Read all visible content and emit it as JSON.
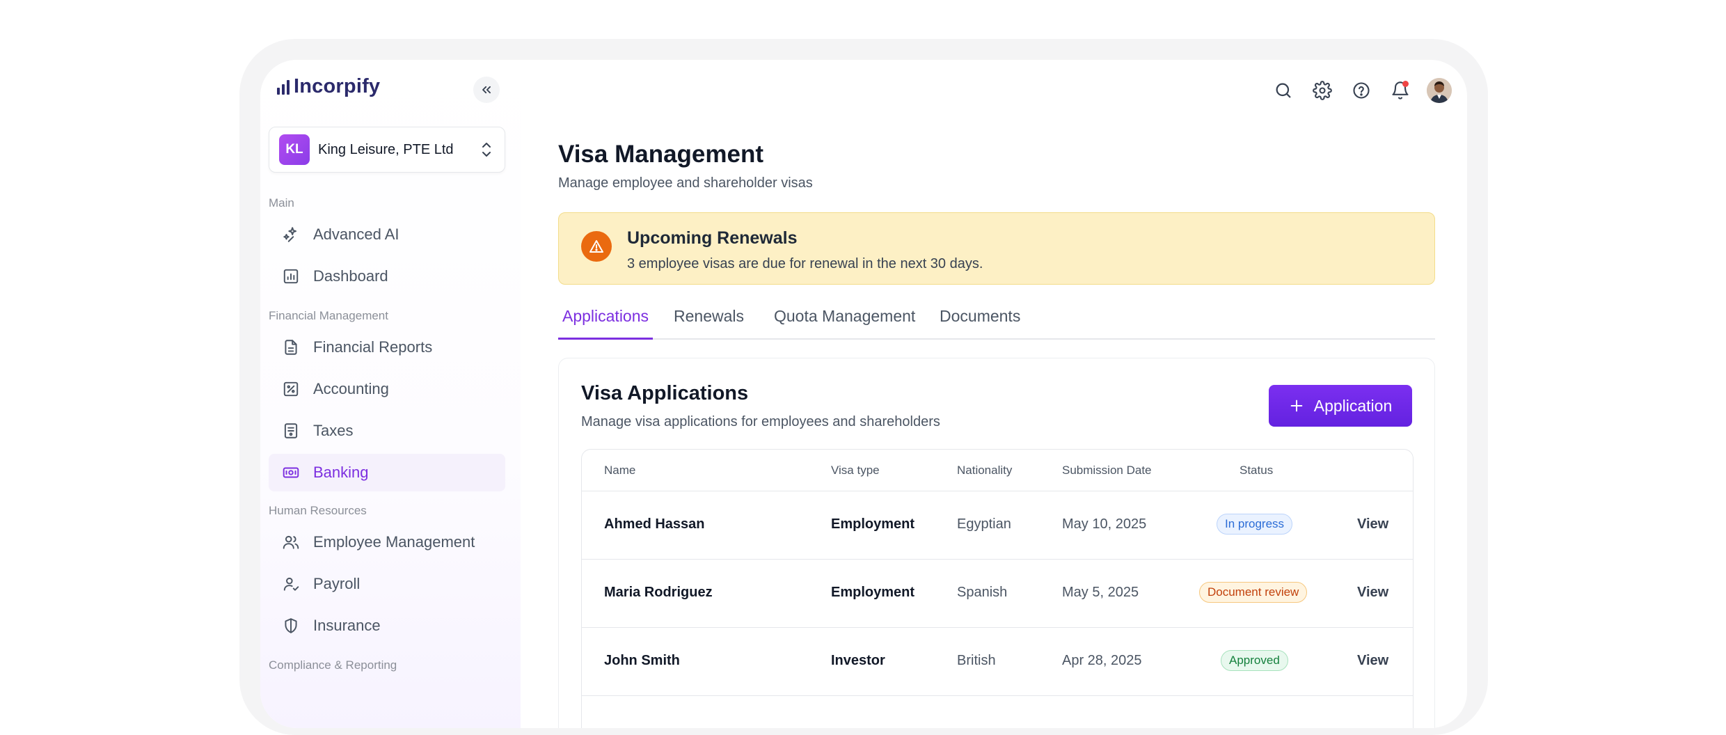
{
  "brand": {
    "name": "Incorpify"
  },
  "company": {
    "initials": "KL",
    "name": "King Leisure, PTE Ltd"
  },
  "sidebar": {
    "sections": [
      "Main",
      "Financial Management",
      "Human Resources",
      "Compliance & Reporting"
    ],
    "items": [
      {
        "label": "Advanced AI",
        "icon": "sparkles-icon"
      },
      {
        "label": "Dashboard",
        "icon": "chart-icon"
      },
      {
        "label": "Financial Reports",
        "icon": "document-icon"
      },
      {
        "label": "Accounting",
        "icon": "percent-icon"
      },
      {
        "label": "Taxes",
        "icon": "receipt-icon"
      },
      {
        "label": "Banking",
        "icon": "banknote-icon",
        "active": true
      },
      {
        "label": "Employee Management",
        "icon": "users-icon"
      },
      {
        "label": "Payroll",
        "icon": "user-check-icon"
      },
      {
        "label": "Insurance",
        "icon": "shield-icon"
      }
    ]
  },
  "header": {
    "icons": [
      "search-icon",
      "gear-icon",
      "help-icon",
      "bell-icon",
      "avatar"
    ]
  },
  "page": {
    "title": "Visa Management",
    "subtitle": "Manage employee and shareholder visas"
  },
  "alert": {
    "title": "Upcoming Renewals",
    "text": "3 employee visas are due for renewal in the next 30 days.",
    "icon": "warning-icon"
  },
  "tabs": [
    {
      "label": "Applications",
      "active": true
    },
    {
      "label": "Renewals"
    },
    {
      "label": "Quota Management"
    },
    {
      "label": "Documents"
    }
  ],
  "card": {
    "title": "Visa Applications",
    "subtitle": "Manage visa applications for employees and shareholders",
    "add_button": "Application"
  },
  "table": {
    "headers": [
      "Name",
      "Visa type",
      "Nationality",
      "Submission Date",
      "Status"
    ],
    "rows": [
      {
        "name": "Ahmed Hassan",
        "visa": "Employment",
        "nationality": "Egyptian",
        "date": "May 10, 2025",
        "status": "In progress",
        "status_kind": "progress",
        "action": "View"
      },
      {
        "name": "Maria Rodriguez",
        "visa": "Employment",
        "nationality": "Spanish",
        "date": "May 5, 2025",
        "status": "Document review",
        "status_kind": "review",
        "action": "View"
      },
      {
        "name": "John Smith",
        "visa": "Investor",
        "nationality": "British",
        "date": "Apr 28, 2025",
        "status": "Approved",
        "status_kind": "approved",
        "action": "View"
      }
    ]
  },
  "colors": {
    "accent": "#7c2fe0",
    "brand": "#2b2a6b",
    "alert_bg": "#fdf0c5",
    "alert_icon": "#ea6a10"
  }
}
